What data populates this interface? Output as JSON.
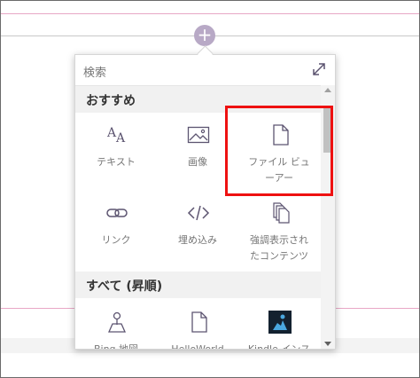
{
  "search": {
    "placeholder": "検索",
    "expand_icon": "expand-diagonal-icon"
  },
  "sections": {
    "recommended": {
      "title": "おすすめ",
      "tiles": [
        {
          "label": "テキスト",
          "icon": "text-icon"
        },
        {
          "label": "画像",
          "icon": "image-icon"
        },
        {
          "label": "ファイル ビュ\nーアー",
          "icon": "document-icon"
        },
        {
          "label": "リンク",
          "icon": "link-icon"
        },
        {
          "label": "埋め込み",
          "icon": "code-icon"
        },
        {
          "label": "強調表示され\nたコンテンツ",
          "icon": "highlighted-content-icon"
        }
      ]
    },
    "all": {
      "title": "すべて (昇順)",
      "tiles": [
        {
          "label": "Bing 地図",
          "icon": "map-pin-icon"
        },
        {
          "label": "HelloWorld",
          "icon": "document-icon"
        },
        {
          "label": "Kindle インス",
          "icon": "kindle-icon"
        }
      ]
    }
  },
  "colors": {
    "accent": "#b8a9c6",
    "highlight": "#ee1111",
    "icon": "#5c5470"
  }
}
